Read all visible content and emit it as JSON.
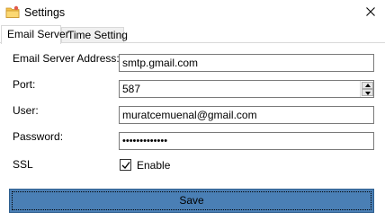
{
  "window": {
    "title": "Settings",
    "icon": "folder-gear-icon",
    "close_label": "close-icon"
  },
  "tabs": [
    {
      "label": "Email Server",
      "active": true
    },
    {
      "label": "Time Setting",
      "active": false
    }
  ],
  "form": {
    "server_label": "Email Server Address:",
    "server_value": "smtp.gmail.com",
    "port_label": "Port:",
    "port_value": "587",
    "user_label": "User:",
    "user_value": "muratcemuenal@gmail.com",
    "password_label": "Password:",
    "password_value": "•••••••••••••",
    "ssl_label": "SSL",
    "ssl_checked": true,
    "ssl_option_label": "Enable"
  },
  "actions": {
    "save_label": "Save"
  },
  "colors": {
    "save_button_bg": "#4a7fb5",
    "icon_folder": "#f5c24a"
  }
}
